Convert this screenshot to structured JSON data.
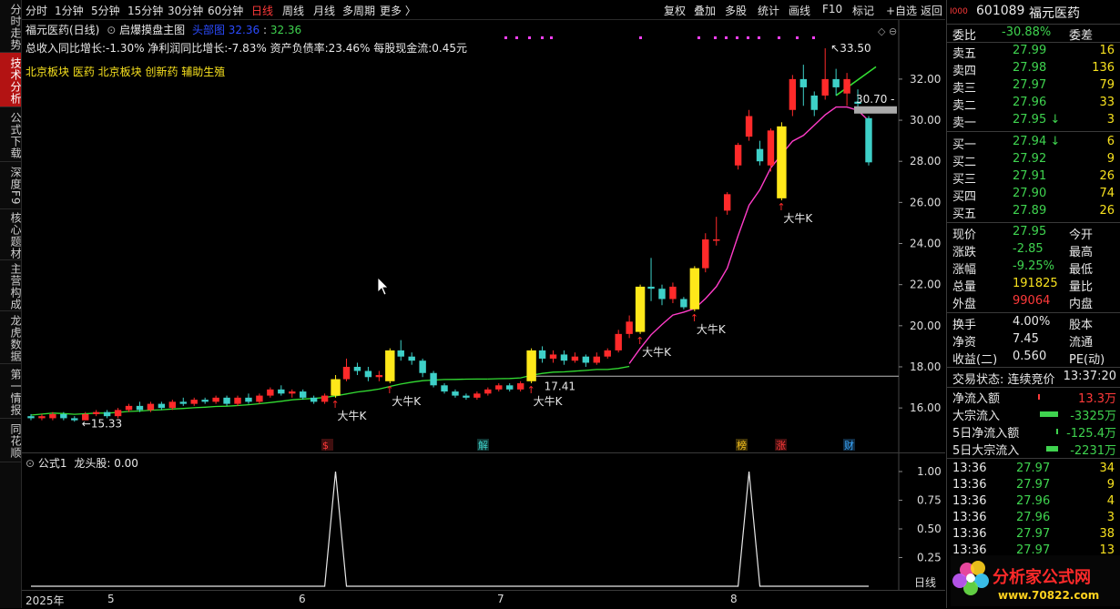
{
  "left_tabs": [
    {
      "label": "分时走势",
      "active": false
    },
    {
      "label": "技术分析",
      "active": true
    },
    {
      "label": "公式下载",
      "active": false
    },
    {
      "label": "深度F9",
      "active": false
    },
    {
      "label": "核心题材",
      "active": false
    },
    {
      "label": "主营构成",
      "active": false
    },
    {
      "label": "龙虎数据",
      "active": false
    },
    {
      "label": "第一情报",
      "active": false
    },
    {
      "label": "同花顺",
      "active": false
    }
  ],
  "toolbar": {
    "periods": [
      "分时",
      "1分钟",
      "5分钟",
      "15分钟",
      "30分钟",
      "60分钟",
      "日线",
      "周线",
      "月线",
      "多周期",
      "更多 〉"
    ],
    "active_period": "日线",
    "tools": [
      "复权",
      "叠加",
      "多股",
      "统计",
      "画线",
      "F10",
      "标记",
      "+自选",
      "返回"
    ]
  },
  "chart_header": {
    "title": "福元医药(日线)",
    "formula": "启爆摸盘主图",
    "ind_name": "头部图",
    "ind_val1": "32.36",
    "ind_val2": "32.36",
    "fundamentals": "总收入同比增长:-1.30%  净利润同比增长:-7.83%  资产负债率:23.46%  每股现金流:0.45元",
    "sectors": "北京板块  医药  北京板块  创新药  辅助生殖"
  },
  "price_labels": {
    "high": "33.50",
    "low": "15.33",
    "line_label": "17.41",
    "right_tag": "30.70"
  },
  "event_markers": [
    {
      "label": "$",
      "color": "#ff3a3a"
    },
    {
      "label": "解",
      "color": "#3ed0c8"
    },
    {
      "label": "榜",
      "color": "#f7c21e"
    },
    {
      "label": "涨",
      "color": "#ff3a3a"
    },
    {
      "label": "财",
      "color": "#3aa8ff"
    }
  ],
  "signal_label": "大牛K",
  "overlap_label": "大牛K",
  "oscillator": {
    "name": "公式1",
    "field": "龙头股: 0.00",
    "y_ticks": [
      "1.00",
      "0.75",
      "0.50",
      "0.25"
    ],
    "period_label": "日线"
  },
  "x_axis": {
    "labels": [
      "2025年",
      "5",
      "6",
      "7",
      "8"
    ]
  },
  "chart_data": {
    "type": "candlestick",
    "title": "福元医药(日线)",
    "y_ticks": [
      32.0,
      30.0,
      28.0,
      26.0,
      24.0,
      22.0,
      20.0,
      18.0,
      16.0
    ],
    "ylim": [
      14.5,
      33.9
    ],
    "candles": [
      {
        "o": 15.6,
        "c": 15.5,
        "h": 15.7,
        "l": 15.4
      },
      {
        "o": 15.5,
        "c": 15.6,
        "h": 15.7,
        "l": 15.4
      },
      {
        "o": 15.5,
        "c": 15.7,
        "h": 15.8,
        "l": 15.4
      },
      {
        "o": 15.7,
        "c": 15.5,
        "h": 15.8,
        "l": 15.4
      },
      {
        "o": 15.5,
        "c": 15.4,
        "h": 15.6,
        "l": 15.33
      },
      {
        "o": 15.4,
        "c": 15.7,
        "h": 15.8,
        "l": 15.4
      },
      {
        "o": 15.7,
        "c": 15.8,
        "h": 15.9,
        "l": 15.6
      },
      {
        "o": 15.8,
        "c": 15.6,
        "h": 15.9,
        "l": 15.5
      },
      {
        "o": 15.6,
        "c": 15.9,
        "h": 16.0,
        "l": 15.5
      },
      {
        "o": 15.9,
        "c": 16.1,
        "h": 16.2,
        "l": 15.8
      },
      {
        "o": 16.1,
        "c": 15.9,
        "h": 16.3,
        "l": 15.8
      },
      {
        "o": 15.9,
        "c": 16.2,
        "h": 16.3,
        "l": 15.8
      },
      {
        "o": 16.2,
        "c": 16.0,
        "h": 16.3,
        "l": 15.9
      },
      {
        "o": 16.0,
        "c": 16.3,
        "h": 16.4,
        "l": 15.9
      },
      {
        "o": 16.3,
        "c": 16.2,
        "h": 16.5,
        "l": 16.1
      },
      {
        "o": 16.2,
        "c": 16.4,
        "h": 16.5,
        "l": 16.1
      },
      {
        "o": 16.4,
        "c": 16.3,
        "h": 16.5,
        "l": 16.2
      },
      {
        "o": 16.3,
        "c": 16.5,
        "h": 16.6,
        "l": 16.2
      },
      {
        "o": 16.5,
        "c": 16.2,
        "h": 16.6,
        "l": 16.1
      },
      {
        "o": 16.2,
        "c": 16.5,
        "h": 16.6,
        "l": 16.1
      },
      {
        "o": 16.5,
        "c": 16.3,
        "h": 16.7,
        "l": 16.2
      },
      {
        "o": 16.3,
        "c": 16.6,
        "h": 16.7,
        "l": 16.2
      },
      {
        "o": 16.6,
        "c": 16.9,
        "h": 17.0,
        "l": 16.5
      },
      {
        "o": 16.9,
        "c": 16.7,
        "h": 17.1,
        "l": 16.6
      },
      {
        "o": 16.7,
        "c": 16.8,
        "h": 16.9,
        "l": 16.5
      },
      {
        "o": 16.8,
        "c": 16.5,
        "h": 16.9,
        "l": 16.4
      },
      {
        "o": 16.5,
        "c": 16.3,
        "h": 16.6,
        "l": 16.2
      },
      {
        "o": 16.3,
        "c": 16.6,
        "h": 16.7,
        "l": 16.2
      },
      {
        "o": 16.6,
        "c": 17.4,
        "h": 17.6,
        "l": 16.5
      },
      {
        "o": 17.4,
        "c": 18.0,
        "h": 18.4,
        "l": 17.3
      },
      {
        "o": 18.0,
        "c": 17.8,
        "h": 18.2,
        "l": 17.6
      },
      {
        "o": 17.8,
        "c": 17.5,
        "h": 18.0,
        "l": 17.3
      },
      {
        "o": 17.5,
        "c": 17.6,
        "h": 17.8,
        "l": 17.3
      },
      {
        "o": 17.3,
        "c": 18.8,
        "h": 18.9,
        "l": 17.2
      },
      {
        "o": 18.8,
        "c": 18.5,
        "h": 19.3,
        "l": 18.3
      },
      {
        "o": 18.5,
        "c": 18.3,
        "h": 18.7,
        "l": 18.1
      },
      {
        "o": 18.3,
        "c": 17.7,
        "h": 18.4,
        "l": 17.5
      },
      {
        "o": 17.7,
        "c": 17.1,
        "h": 17.8,
        "l": 17.0
      },
      {
        "o": 17.1,
        "c": 16.8,
        "h": 17.2,
        "l": 16.7
      },
      {
        "o": 16.8,
        "c": 16.6,
        "h": 16.9,
        "l": 16.5
      },
      {
        "o": 16.6,
        "c": 16.5,
        "h": 16.7,
        "l": 16.4
      },
      {
        "o": 16.5,
        "c": 16.7,
        "h": 16.8,
        "l": 16.4
      },
      {
        "o": 16.7,
        "c": 16.9,
        "h": 17.0,
        "l": 16.6
      },
      {
        "o": 16.9,
        "c": 17.1,
        "h": 17.2,
        "l": 16.8
      },
      {
        "o": 17.1,
        "c": 16.9,
        "h": 17.2,
        "l": 16.8
      },
      {
        "o": 16.9,
        "c": 17.2,
        "h": 17.3,
        "l": 16.8
      },
      {
        "o": 17.3,
        "c": 18.8,
        "h": 18.9,
        "l": 17.2
      },
      {
        "o": 18.8,
        "c": 18.4,
        "h": 19.0,
        "l": 18.2
      },
      {
        "o": 18.4,
        "c": 18.6,
        "h": 18.8,
        "l": 18.2
      },
      {
        "o": 18.6,
        "c": 18.3,
        "h": 18.8,
        "l": 18.1
      },
      {
        "o": 18.3,
        "c": 18.5,
        "h": 18.7,
        "l": 18.2
      },
      {
        "o": 18.5,
        "c": 18.2,
        "h": 18.6,
        "l": 18.0
      },
      {
        "o": 18.2,
        "c": 18.5,
        "h": 18.7,
        "l": 18.1
      },
      {
        "o": 18.5,
        "c": 18.8,
        "h": 18.9,
        "l": 18.4
      },
      {
        "o": 18.8,
        "c": 19.6,
        "h": 19.8,
        "l": 18.7
      },
      {
        "o": 19.6,
        "c": 20.2,
        "h": 20.5,
        "l": 19.4
      },
      {
        "o": 19.7,
        "c": 21.9,
        "h": 22.0,
        "l": 19.6
      },
      {
        "o": 21.9,
        "c": 21.8,
        "h": 23.3,
        "l": 21.2
      },
      {
        "o": 21.8,
        "c": 21.3,
        "h": 22.0,
        "l": 21.0
      },
      {
        "o": 21.3,
        "c": 21.9,
        "h": 22.1,
        "l": 21.1
      },
      {
        "o": 21.3,
        "c": 20.9,
        "h": 21.4,
        "l": 20.8
      },
      {
        "o": 20.8,
        "c": 22.8,
        "h": 22.9,
        "l": 20.7
      },
      {
        "o": 22.8,
        "c": 24.2,
        "h": 24.5,
        "l": 22.6
      },
      {
        "o": 24.2,
        "c": 24.2,
        "h": 25.3,
        "l": 23.9
      },
      {
        "o": 25.6,
        "c": 26.4,
        "h": 26.5,
        "l": 25.4
      },
      {
        "o": 27.8,
        "c": 28.8,
        "h": 28.9,
        "l": 27.6
      },
      {
        "o": 29.2,
        "c": 30.2,
        "h": 30.5,
        "l": 29.0
      },
      {
        "o": 28.6,
        "c": 28.0,
        "h": 29.0,
        "l": 27.8
      },
      {
        "o": 27.8,
        "c": 29.5,
        "h": 29.6,
        "l": 27.5
      },
      {
        "o": 26.2,
        "c": 29.7,
        "h": 29.9,
        "l": 26.1
      },
      {
        "o": 30.5,
        "c": 32.0,
        "h": 32.2,
        "l": 30.2
      },
      {
        "o": 32.0,
        "c": 31.6,
        "h": 32.7,
        "l": 30.7
      },
      {
        "o": 31.2,
        "c": 30.5,
        "h": 31.4,
        "l": 30.2
      },
      {
        "o": 31.2,
        "c": 32.0,
        "h": 33.5,
        "l": 31.0
      },
      {
        "o": 32.0,
        "c": 31.6,
        "h": 32.5,
        "l": 31.2
      },
      {
        "o": 31.3,
        "c": 32.0,
        "h": 32.3,
        "l": 30.7
      },
      {
        "o": 30.9,
        "c": 30.8,
        "h": 31.5,
        "l": 30.5
      },
      {
        "o": 30.1,
        "c": 27.95,
        "h": 30.2,
        "l": 27.8
      }
    ],
    "big_bull_days": [
      28,
      33,
      46,
      56,
      61,
      69
    ]
  },
  "stock": {
    "code": "601089",
    "name": "福元医药",
    "ratio_label": "委比",
    "ratio_value": "-30.88%",
    "diff_label": "委差",
    "asks": [
      {
        "label": "卖五",
        "price": "27.99",
        "vol": "16"
      },
      {
        "label": "卖四",
        "price": "27.98",
        "vol": "136"
      },
      {
        "label": "卖三",
        "price": "27.97",
        "vol": "79"
      },
      {
        "label": "卖二",
        "price": "27.96",
        "vol": "33"
      },
      {
        "label": "卖一",
        "price": "27.95",
        "vol": "3",
        "arrow": "↓"
      }
    ],
    "bids": [
      {
        "label": "买一",
        "price": "27.94",
        "vol": "6",
        "arrow": "↓"
      },
      {
        "label": "买二",
        "price": "27.92",
        "vol": "9"
      },
      {
        "label": "买三",
        "price": "27.91",
        "vol": "26"
      },
      {
        "label": "买四",
        "price": "27.90",
        "vol": "74"
      },
      {
        "label": "买五",
        "price": "27.89",
        "vol": "26"
      }
    ],
    "quote": [
      {
        "l1": "现价",
        "v1": "27.95",
        "c1": "g",
        "l2": "今开"
      },
      {
        "l1": "涨跌",
        "v1": "-2.85",
        "c1": "g",
        "l2": "最高"
      },
      {
        "l1": "涨幅",
        "v1": "-9.25%",
        "c1": "g",
        "l2": "最低"
      },
      {
        "l1": "总量",
        "v1": "191825",
        "c1": "y",
        "l2": "量比"
      },
      {
        "l1": "外盘",
        "v1": "99064",
        "c1": "r",
        "l2": "内盘"
      }
    ],
    "quote2": [
      {
        "l1": "换手",
        "v1": "4.00%",
        "l2": "股本"
      },
      {
        "l1": "净资",
        "v1": "7.45",
        "l2": "流通"
      },
      {
        "l1": "收益(二)",
        "v1": "0.560",
        "l2": "PE(动)"
      }
    ],
    "trade_status": "交易状态: 连续竞价",
    "trade_time": "13:37:20",
    "flows": [
      {
        "label": "净流入额",
        "value": "13.3万",
        "color": "r",
        "bar": 0.02
      },
      {
        "label": "大宗流入",
        "value": "-3325万",
        "color": "g",
        "bar": 0.9
      },
      {
        "label": "5日净流入额",
        "value": "-125.4万",
        "color": "g",
        "bar": 0.1
      },
      {
        "label": "5日大宗流入",
        "value": "-2231万",
        "color": "g",
        "bar": 0.6
      }
    ],
    "ticks": [
      {
        "time": "13:36",
        "price": "27.97",
        "vol": "34"
      },
      {
        "time": "13:36",
        "price": "27.97",
        "vol": "9"
      },
      {
        "time": "13:36",
        "price": "27.96",
        "vol": "4"
      },
      {
        "time": "13:36",
        "price": "27.96",
        "vol": "3"
      },
      {
        "time": "13:36",
        "price": "27.97",
        "vol": "38"
      },
      {
        "time": "13:36",
        "price": "27.97",
        "vol": "13"
      }
    ]
  },
  "watermark": {
    "brand": "分析家公式网",
    "url": "www.70822.com"
  },
  "colors": {
    "up": "#ff2a2a",
    "down": "#3ed0c8",
    "signal": "#ffe81a",
    "ma_green": "#33dd33",
    "ma_pink": "#ff3cc8"
  }
}
